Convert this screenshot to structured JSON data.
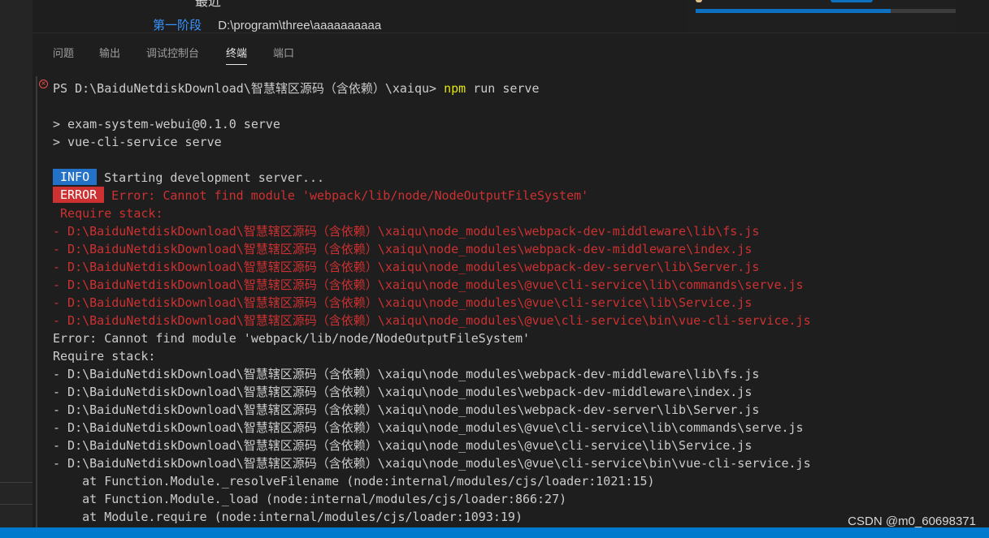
{
  "editor": {
    "heading_partial": "最近",
    "stage_label": "第一阶段",
    "path": "D:\\program\\three\\aaaaaaaaaa",
    "progress_fraction": 0.75
  },
  "panel": {
    "tabs": [
      "问题",
      "输出",
      "调试控制台",
      "终端",
      "端口"
    ],
    "active_tab": "终端"
  },
  "terminal": {
    "prompt": "PS D:\\BaiduNetdiskDownload\\智慧辖区源码（含依赖）\\xaiqu> ",
    "command_name": "npm",
    "command_args": " run serve",
    "script_lines": [
      "> exam-system-webui@0.1.0 serve",
      "> vue-cli-service serve"
    ],
    "info_badge": "INFO",
    "info_text": "Starting development server...",
    "error_badge": "ERROR",
    "error_text": "Error: Cannot find module 'webpack/lib/node/NodeOutputFileSystem'",
    "red_require_stack": " Require stack:",
    "red_stack": [
      "- D:\\BaiduNetdiskDownload\\智慧辖区源码（含依赖）\\xaiqu\\node_modules\\webpack-dev-middleware\\lib\\fs.js",
      "- D:\\BaiduNetdiskDownload\\智慧辖区源码（含依赖）\\xaiqu\\node_modules\\webpack-dev-middleware\\index.js",
      "- D:\\BaiduNetdiskDownload\\智慧辖区源码（含依赖）\\xaiqu\\node_modules\\webpack-dev-server\\lib\\Server.js",
      "- D:\\BaiduNetdiskDownload\\智慧辖区源码（含依赖）\\xaiqu\\node_modules\\@vue\\cli-service\\lib\\commands\\serve.js",
      "- D:\\BaiduNetdiskDownload\\智慧辖区源码（含依赖）\\xaiqu\\node_modules\\@vue\\cli-service\\lib\\Service.js",
      "- D:\\BaiduNetdiskDownload\\智慧辖区源码（含依赖）\\xaiqu\\node_modules\\@vue\\cli-service\\bin\\vue-cli-service.js"
    ],
    "plain_error": "Error: Cannot find module 'webpack/lib/node/NodeOutputFileSystem'",
    "plain_require_stack": "Require stack:",
    "plain_stack": [
      "- D:\\BaiduNetdiskDownload\\智慧辖区源码（含依赖）\\xaiqu\\node_modules\\webpack-dev-middleware\\lib\\fs.js",
      "- D:\\BaiduNetdiskDownload\\智慧辖区源码（含依赖）\\xaiqu\\node_modules\\webpack-dev-middleware\\index.js",
      "- D:\\BaiduNetdiskDownload\\智慧辖区源码（含依赖）\\xaiqu\\node_modules\\webpack-dev-server\\lib\\Server.js",
      "- D:\\BaiduNetdiskDownload\\智慧辖区源码（含依赖）\\xaiqu\\node_modules\\@vue\\cli-service\\lib\\commands\\serve.js",
      "- D:\\BaiduNetdiskDownload\\智慧辖区源码（含依赖）\\xaiqu\\node_modules\\@vue\\cli-service\\lib\\Service.js",
      "- D:\\BaiduNetdiskDownload\\智慧辖区源码（含依赖）\\xaiqu\\node_modules\\@vue\\cli-service\\bin\\vue-cli-service.js"
    ],
    "trace": [
      "    at Function.Module._resolveFilename (node:internal/modules/cjs/loader:1021:15)",
      "    at Function.Module._load (node:internal/modules/cjs/loader:866:27)",
      "    at Module.require (node:internal/modules/cjs/loader:1093:19)"
    ]
  },
  "watermark": "CSDN @m0_60698371",
  "colors": {
    "background": "#1e1e1e",
    "error_red": "#cd3131",
    "command_yellow": "#e5e510",
    "info_blue": "#2472c8",
    "status_blue": "#007acc",
    "link_blue": "#3794ff"
  },
  "icons": {
    "error_marker": "error-circle-icon"
  }
}
